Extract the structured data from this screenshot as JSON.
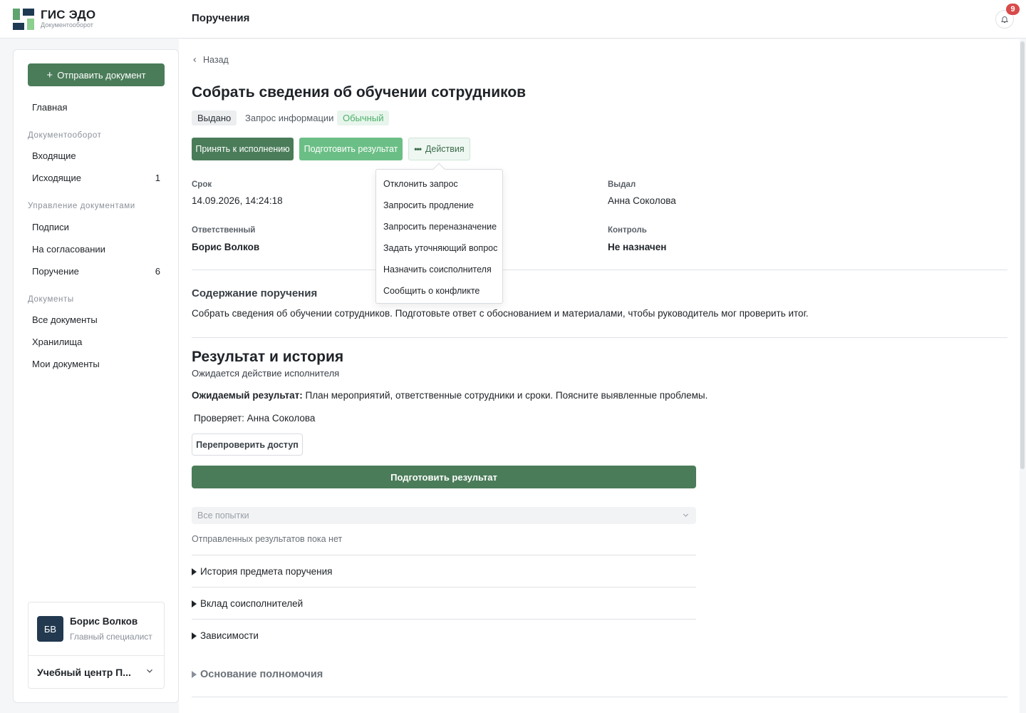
{
  "app": {
    "title": "ГИС ЭДО",
    "subtitle": "Документооборот"
  },
  "header": {
    "page_title": "Поручения",
    "notifications_count": "9"
  },
  "sidebar": {
    "send_label": "Отправить документ",
    "home": "Главная",
    "sections": [
      {
        "title": "Документооборот",
        "items": [
          {
            "label": "Входящие",
            "count": ""
          },
          {
            "label": "Исходящие",
            "count": "1"
          }
        ]
      },
      {
        "title": "Управление документами",
        "items": [
          {
            "label": "Подписи",
            "count": ""
          },
          {
            "label": "На согласовании",
            "count": ""
          },
          {
            "label": "Поручение",
            "count": "6"
          }
        ]
      },
      {
        "title": "Документы",
        "items": [
          {
            "label": "Все документы",
            "count": ""
          },
          {
            "label": "Хранилища",
            "count": ""
          },
          {
            "label": "Мои документы",
            "count": ""
          }
        ]
      }
    ],
    "user": {
      "initials": "БВ",
      "name": "Борис Волков",
      "role": "Главный специалист"
    },
    "org": "Учебный центр П..."
  },
  "task": {
    "back_label": "Назад",
    "title": "Собрать сведения об обучении сотрудников",
    "status": "Выдано",
    "type": "Запрос информации",
    "priority": "Обычный",
    "buttons": {
      "accept": "Принять к исполнению",
      "prepare": "Подготовить результат",
      "actions": "Действия"
    },
    "fields": {
      "deadline_label": "Срок",
      "deadline": "14.09.2026, 14:24:18",
      "issuer_label": "Выдал",
      "issuer": "Анна Соколова",
      "responsible_label": "Ответственный",
      "responsible": "Борис Волков",
      "control_label": "Контроль",
      "control": "Не назначен"
    },
    "content_title": "Содержание поручения",
    "content_text": "Собрать сведения об обучении сотрудников. Подготовьте ответ с обоснованием и материалами, чтобы руководитель мог проверить итог."
  },
  "actions_menu": [
    "Отклонить запрос",
    "Запросить продление",
    "Запросить переназначение",
    "Задать уточняющий вопрос",
    "Назначить соисполнителя",
    "Сообщить о конфликте"
  ],
  "result": {
    "title": "Результат и история",
    "status_text": "Ожидается действие исполнителя",
    "expected_label": "Ожидаемый результат:",
    "expected_text": "План мероприятий, ответственные сотрудники и сроки. Поясните выявленные проблемы.",
    "checker": "Проверяет: Анна Соколова",
    "recheck_label": "Перепроверить доступ",
    "prepare_label": "Подготовить результат",
    "attempts_placeholder": "Все попытки",
    "empty_note": "Отправленных результатов пока нет",
    "sections": [
      "История предмета поручения",
      "Вклад соисполнителей",
      "Зависимости"
    ],
    "authority_label": "Основание полномочия"
  },
  "colors": {
    "primary": "#4a7c59",
    "primary_light": "#6bbf86",
    "accent_badge": "#d94a4a",
    "sidebar_dark": "#22394f"
  }
}
